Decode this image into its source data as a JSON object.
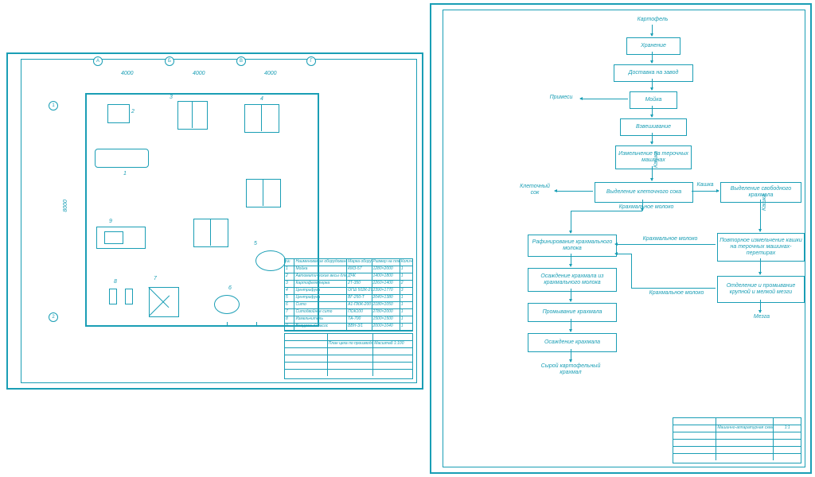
{
  "flowchart": {
    "nodes": {
      "n1": "Картофель",
      "n2": "Хранение",
      "n3": "Доставка на завод",
      "n4": "Мойка",
      "n5": "Взвешивание",
      "n6": "Измельчение на терочных машинах",
      "n7": "Выделение клеточного сока",
      "n8": "Выделение свободного крахмала",
      "n9": "Рафинирование крахмального молока",
      "n10": "Повторное измельчение кашки на терочных машинах-перетирах",
      "n11": "Осаждение крахмала из крахмального молока",
      "n12": "Отделение и промывание крупной и мелкой мезги",
      "n13": "Промывание крахмала",
      "n14": "Осаждение крахмала",
      "n15": "Сырой картофельный крахмал"
    },
    "labels": {
      "primesi": "Примеси",
      "kashka1": "Кашка",
      "kashka2": "Кашка",
      "kashka3": "Кашка",
      "sok": "Клеточный сок",
      "moloko1": "Крахмальное молоко",
      "moloko2": "Крахмальное молоко",
      "moloko3": "Крахмальное молоко",
      "mezga": "Мезга"
    },
    "title": "Машинно-аппаратурная схема производства крахмала из картофеля"
  },
  "floorplan": {
    "dims": {
      "span1": "4000",
      "span2": "4000",
      "span3": "4000",
      "vspan": "8000"
    },
    "axes": {
      "A": "А",
      "B": "Б",
      "V": "В",
      "G": "Г",
      "one": "1",
      "two": "2"
    },
    "equipNumbers": [
      "1",
      "2",
      "3",
      "4",
      "5",
      "6",
      "7",
      "8",
      "9"
    ],
    "table": {
      "headers": [
        "№",
        "Наименование оборудования",
        "Марка оборудования",
        "Размер на плане",
        "Количество"
      ],
      "rows": [
        [
          "1",
          "Мойка",
          "КМЗ-57",
          "1280×2000",
          "1"
        ],
        [
          "2",
          "Автоматические весы для картофеля",
          "ДЧК",
          "1400×1800",
          "1"
        ],
        [
          "3",
          "Картофелетерка",
          "2Т-350",
          "2260×1400",
          "2"
        ],
        [
          "4",
          "Центрифуга",
          "ОГШ 502К-2Т",
          "2390×1770",
          "3"
        ],
        [
          "5",
          "Центрифуга",
          "ВГ-250-Т",
          "2040×1380",
          "1"
        ],
        [
          "6",
          "Сито",
          "А1-ПКЖ-200",
          "2180×1050",
          "1"
        ],
        [
          "7",
          "Ситодвойное сито",
          "ПОК100",
          "2780×2000",
          "1"
        ],
        [
          "8",
          "Измельчитель",
          "ТА-700",
          "1500×1500",
          "1"
        ],
        [
          "9",
          "Вакуумный насос",
          "ВВН-3/1",
          "2000×1040",
          "1"
        ]
      ]
    },
    "title": "План цеха по производству сырого крахмала",
    "scale": "Масштаб 1:100"
  }
}
